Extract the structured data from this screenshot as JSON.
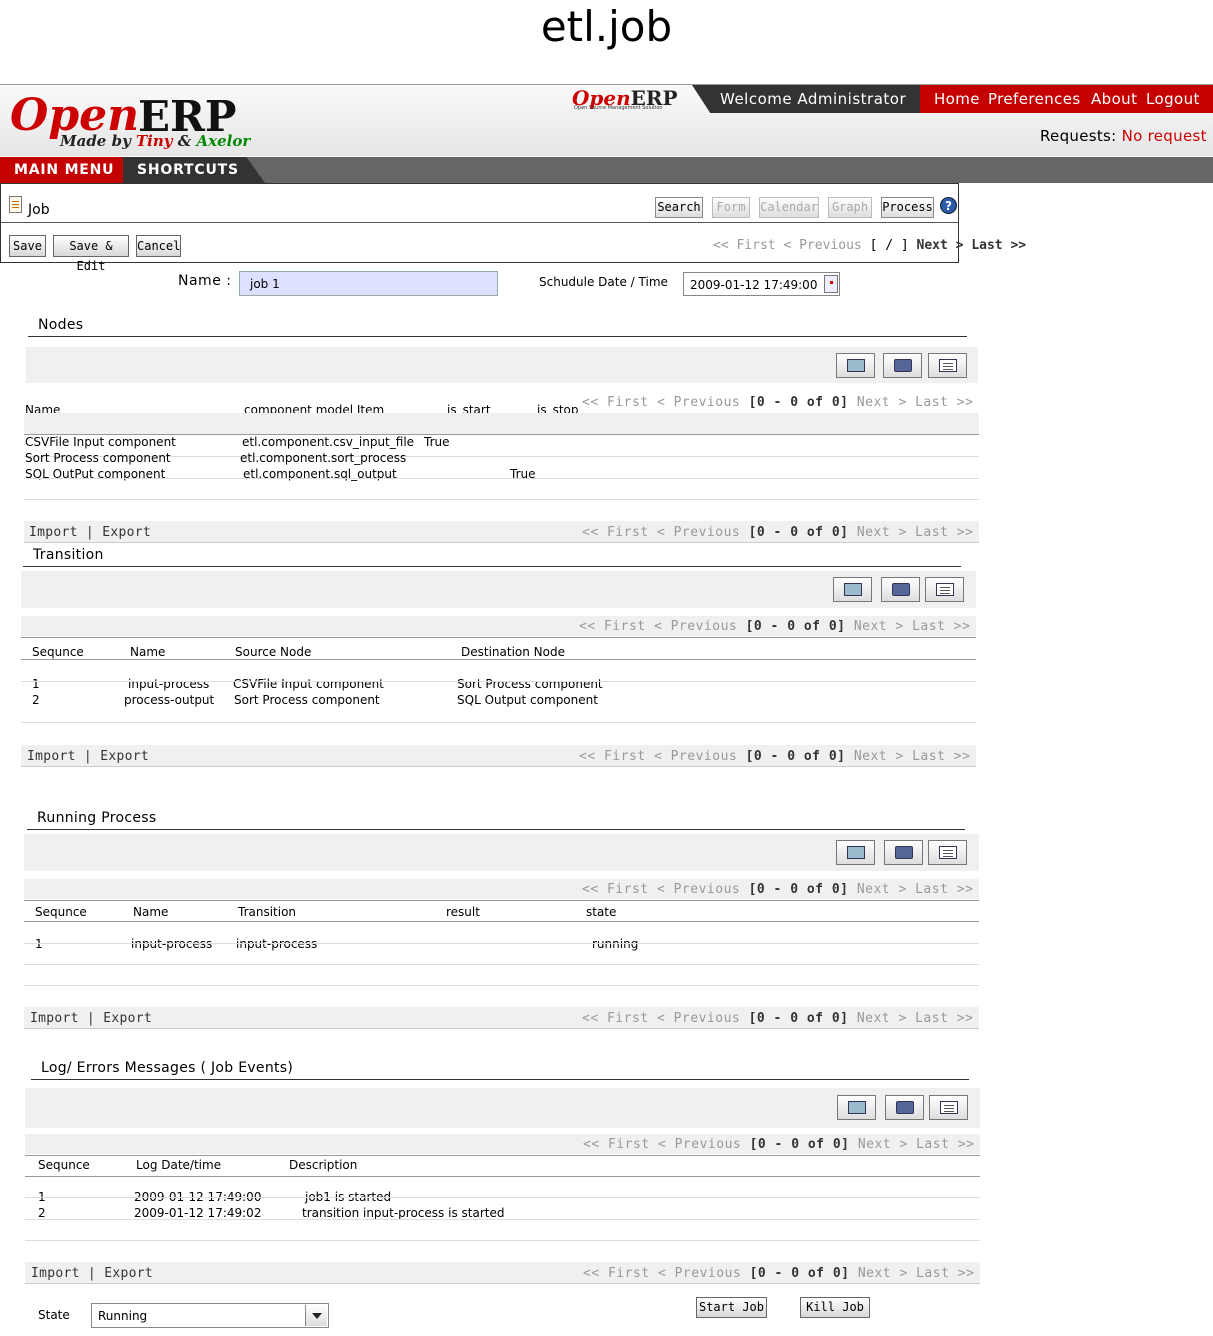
{
  "page_title": "etl.job",
  "header": {
    "logo_open": "Open",
    "logo_erp": "ERP",
    "logo_made_by": "Made by",
    "logo_tiny": "Tiny",
    "logo_amp": "&",
    "logo_axelor": "Axelor",
    "small_logo_open": "Open",
    "small_logo_erp": "ERP",
    "small_logo_sub": "Open Source Management Solution",
    "welcome": "Welcome Administrator",
    "nav": [
      "Home",
      "Preferences",
      "About",
      "Logout"
    ],
    "requests_label": "Requests:",
    "requests_value": "No request",
    "main_menu": "MAIN MENU",
    "shortcuts": "SHORTCUTS"
  },
  "toolbar": {
    "title": "Job",
    "views": [
      "Search",
      "Form",
      "Calendar",
      "Graph",
      "Process"
    ],
    "help": "?",
    "save": "Save",
    "save_edit": "Save & Edit",
    "cancel": "Cancel",
    "pager_first": "<< First",
    "pager_prev": "< Previous",
    "pager_mid": "[ / ]",
    "pager_next": "Next >",
    "pager_last": "Last >>"
  },
  "form": {
    "name_label": "Name :",
    "name_value": "job 1",
    "schedule_label": "Schudule Date / Time",
    "schedule_value": "2009-01-12 17:49:00"
  },
  "grid_pager": {
    "first": "<< First",
    "prev": "< Previous",
    "count": "[0 - 0 of 0]",
    "next": "Next >",
    "last": "Last >>"
  },
  "grid_footer": {
    "import": "Import",
    "sep": "|",
    "export": "Export"
  },
  "nodes": {
    "title": "Nodes",
    "columns": [
      "Name",
      "component model Item",
      "is_start",
      "is_stop"
    ],
    "rows": [
      [
        "CSVFile Input component",
        "etl.component.csv_input_file",
        "True",
        ""
      ],
      [
        "Sort Process component",
        "etl.component.sort_process",
        "",
        ""
      ],
      [
        "SQL OutPut component",
        "etl.component.sql_output",
        "",
        "True"
      ]
    ]
  },
  "transition": {
    "title": "Transition",
    "columns": [
      "Sequnce",
      "Name",
      "Source Node",
      "Destination Node"
    ],
    "rows": [
      [
        "1",
        "input-process",
        "CSVFile Input component",
        "Sort Process component"
      ],
      [
        "2",
        "process-output",
        "Sort Process component",
        "SQL Output component"
      ]
    ]
  },
  "running": {
    "title": "Running Process",
    "columns": [
      "Sequnce",
      "Name",
      "Transition",
      "result",
      "state"
    ],
    "rows": [
      [
        "1",
        "input-process",
        "input-process",
        "",
        "running"
      ]
    ]
  },
  "log": {
    "title": "Log/ Errors Messages ( Job Events)",
    "columns": [
      "Sequnce",
      "Log Date/time",
      "Description"
    ],
    "rows": [
      [
        "1",
        "2009-01-12 17:49:00",
        "job1  is started"
      ],
      [
        "2",
        "2009-01-12 17:49:02",
        "transition input-process  is started"
      ]
    ]
  },
  "footer": {
    "state_label": "State",
    "state_value": "Running",
    "start_job": "Start Job",
    "kill_job": "Kill Job"
  }
}
